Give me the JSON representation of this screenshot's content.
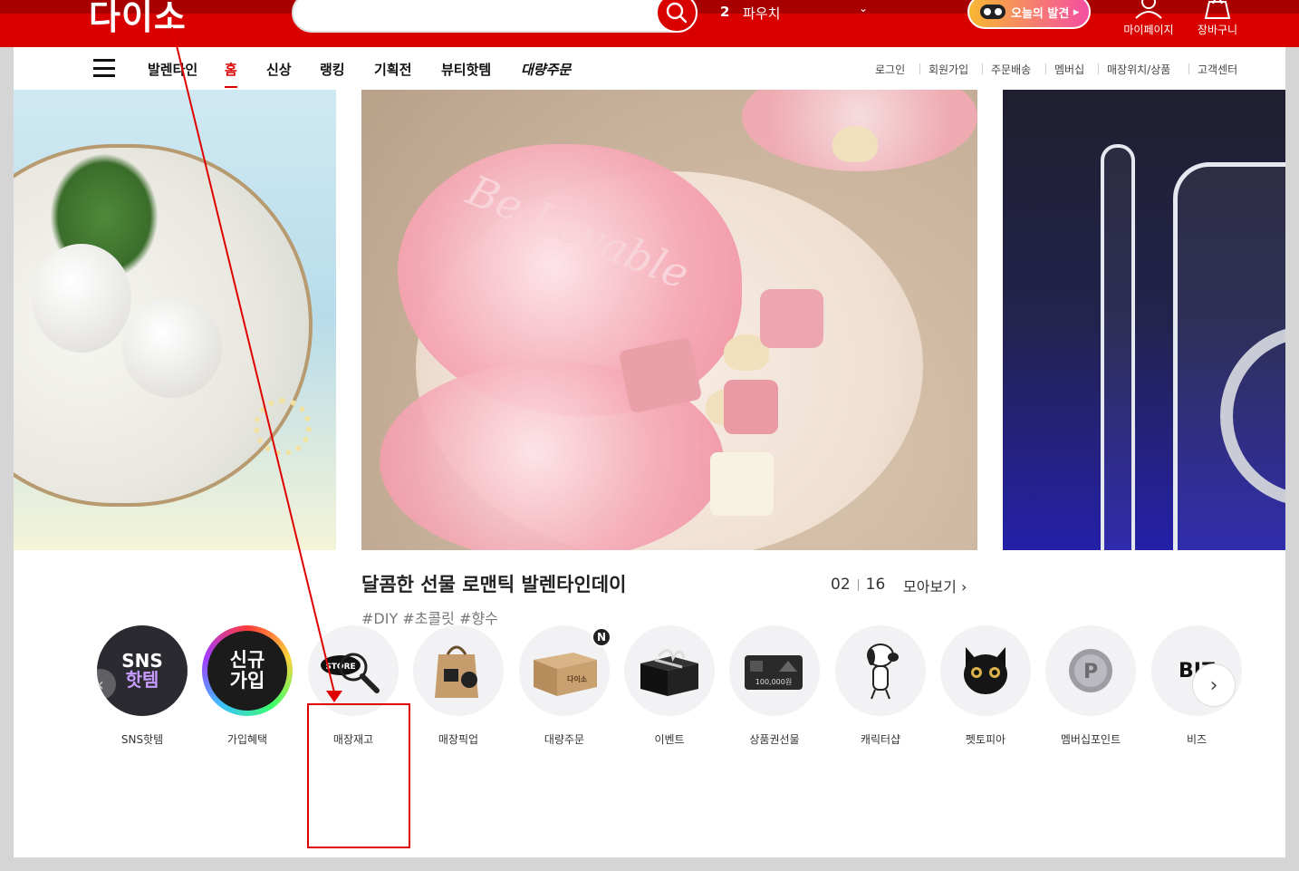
{
  "header": {
    "logo": "다이소",
    "search_placeholder": "",
    "ranking": {
      "rank": "2",
      "keyword": "파우치"
    },
    "discover_label": "오늘의 발견",
    "mypage_label": "마이페이지",
    "cart_label": "장바구니"
  },
  "nav": {
    "items": [
      {
        "label": "발렌타인",
        "active": false
      },
      {
        "label": "홈",
        "active": true
      },
      {
        "label": "신상",
        "active": false
      },
      {
        "label": "랭킹",
        "active": false
      },
      {
        "label": "기획전",
        "active": false
      },
      {
        "label": "뷰티핫템",
        "active": false
      },
      {
        "label": "대량주문",
        "active": false
      }
    ],
    "utility": [
      "로그인",
      "회원가입",
      "주문배송",
      "멤버십",
      "매장위치/상품",
      "고객센터"
    ]
  },
  "banner": {
    "center_script": "Be Lovable",
    "title": "달콤한 선물 로맨틱 발렌타인데이",
    "tags": "#DIY #초콜릿 #향수",
    "current": "02",
    "total": "16",
    "more_label": "모아보기 ›"
  },
  "shortcuts": {
    "items": [
      {
        "label": "SNS핫템",
        "icon_text_1": "SNS",
        "icon_text_2": "핫템"
      },
      {
        "label": "가입혜택",
        "icon_text_1": "신규",
        "icon_text_2": "가입"
      },
      {
        "label": "매장재고",
        "icon_text_1": "STORE"
      },
      {
        "label": "매장픽업"
      },
      {
        "label": "대량주문",
        "icon_text_1": "다이소",
        "badge": "N"
      },
      {
        "label": "이벤트"
      },
      {
        "label": "상품권선물",
        "icon_text_1": "100,000원"
      },
      {
        "label": "캐릭터샵"
      },
      {
        "label": "펫토피아"
      },
      {
        "label": "멤버십포인트",
        "icon_text_1": "P"
      },
      {
        "label": "비즈",
        "icon_text_1": "BIZ"
      }
    ]
  },
  "colors": {
    "brand": "#d90000",
    "annotation": "#e00000"
  }
}
